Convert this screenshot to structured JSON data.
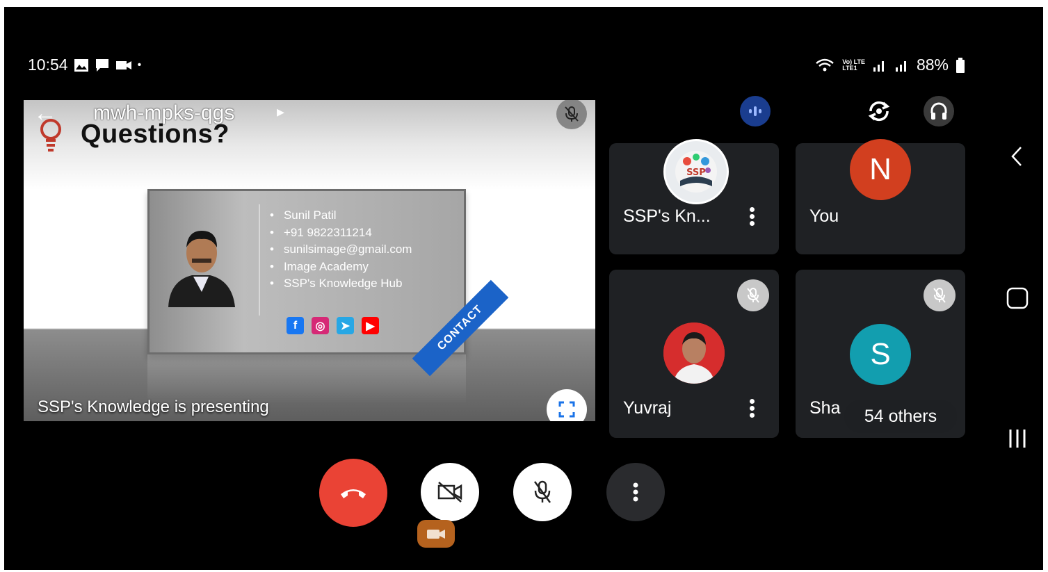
{
  "status_bar": {
    "time": "10:54",
    "dot": "•",
    "left_icons": [
      "gallery-icon",
      "message-icon",
      "video-recording-icon"
    ],
    "network_label": "Vo) LTE",
    "network_sub": "LTE1",
    "battery": "88%"
  },
  "meeting": {
    "code": "mwh-mpks-qgs"
  },
  "presentation": {
    "presenter_text": "SSP's Knowledge is presenting",
    "slide": {
      "title": "Questions?",
      "contacts": [
        "Sunil Patil",
        "+91 9822311214",
        "sunilsimage@gmail.com",
        "Image Academy",
        "SSP's Knowledge Hub"
      ],
      "ribbon": "CONTACT",
      "socials": [
        {
          "name": "facebook",
          "glyph": "f",
          "color": "#1877f2"
        },
        {
          "name": "instagram",
          "glyph": "◎",
          "color": "#d62976"
        },
        {
          "name": "telegram",
          "glyph": "➤",
          "color": "#27a7e5"
        },
        {
          "name": "youtube",
          "glyph": "▶",
          "color": "#ff0000"
        }
      ],
      "avatar_logo_text": "SSP"
    }
  },
  "participants": [
    {
      "name": "SSP's Kn...",
      "avatar_type": "logo",
      "avatar_text": "SSP",
      "muted": false,
      "has_menu": true
    },
    {
      "name": "You",
      "avatar_type": "letter",
      "avatar_text": "N",
      "avatar_color": "#d23f1f",
      "muted": false,
      "has_menu": false
    },
    {
      "name": "Yuvraj",
      "avatar_type": "photo",
      "avatar_text": "",
      "muted": true,
      "has_menu": true
    },
    {
      "name": "Sha",
      "avatar_type": "letter",
      "avatar_text": "S",
      "avatar_color": "#129eaf",
      "muted": true,
      "has_menu": false
    }
  ],
  "others_count": "54 others",
  "colors": {
    "end_call": "#ea4335",
    "tile_bg": "#1f2124",
    "speaking_indicator": "#1a3d8f"
  },
  "controls": [
    "end-call-button",
    "camera-off-button",
    "mic-off-button",
    "more-options-button"
  ]
}
